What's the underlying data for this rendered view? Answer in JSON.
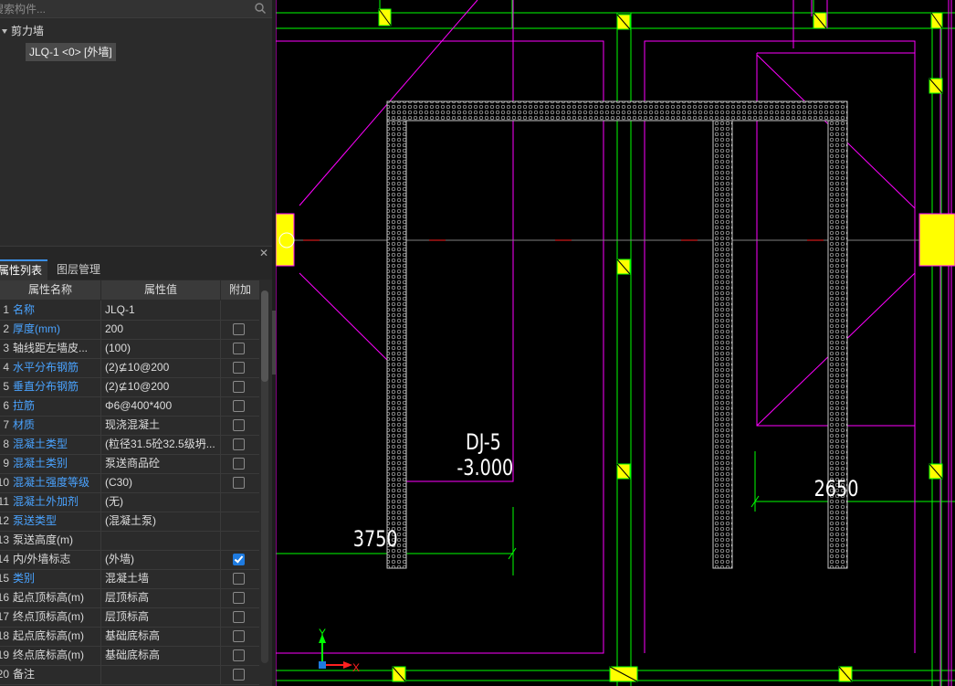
{
  "search": {
    "placeholder": "搜索构件..."
  },
  "tree": {
    "root_label": "剪力墙",
    "child_label": "JLQ-1 <0> [外墙]"
  },
  "tabs": [
    {
      "label": "属性列表",
      "active": true
    },
    {
      "label": "图层管理",
      "active": false
    }
  ],
  "table": {
    "headers": [
      "属性名称",
      "属性值",
      "附加"
    ],
    "rows": [
      {
        "no": "1",
        "name": "名称",
        "value": "JLQ-1",
        "blue": true,
        "check": null
      },
      {
        "no": "2",
        "name": "厚度(mm)",
        "value": "200",
        "blue": true,
        "check": false
      },
      {
        "no": "3",
        "name": "轴线距左墙皮...",
        "value": "(100)",
        "blue": false,
        "check": false
      },
      {
        "no": "4",
        "name": "水平分布钢筋",
        "value": "(2)⊈10@200",
        "blue": true,
        "check": false
      },
      {
        "no": "5",
        "name": "垂直分布钢筋",
        "value": "(2)⊈10@200",
        "blue": true,
        "check": false
      },
      {
        "no": "6",
        "name": "拉筋",
        "value": "Φ6@400*400",
        "blue": true,
        "check": false
      },
      {
        "no": "7",
        "name": "材质",
        "value": "现浇混凝土",
        "blue": true,
        "check": false
      },
      {
        "no": "8",
        "name": "混凝土类型",
        "value": "(粒径31.5砼32.5级坍...",
        "blue": true,
        "check": false
      },
      {
        "no": "9",
        "name": "混凝土类别",
        "value": "泵送商品砼",
        "blue": true,
        "check": false
      },
      {
        "no": "10",
        "name": "混凝土强度等级",
        "value": "(C30)",
        "blue": true,
        "check": false
      },
      {
        "no": "11",
        "name": "混凝土外加剂",
        "value": "(无)",
        "blue": true,
        "check": null
      },
      {
        "no": "12",
        "name": "泵送类型",
        "value": "(混凝土泵)",
        "blue": true,
        "check": null
      },
      {
        "no": "13",
        "name": "泵送高度(m)",
        "value": "",
        "blue": false,
        "check": null
      },
      {
        "no": "14",
        "name": "内/外墙标志",
        "value": "(外墙)",
        "blue": false,
        "check": true
      },
      {
        "no": "15",
        "name": "类别",
        "value": "混凝土墙",
        "blue": true,
        "check": false
      },
      {
        "no": "16",
        "name": "起点顶标高(m)",
        "value": "层顶标高",
        "blue": false,
        "check": false
      },
      {
        "no": "17",
        "name": "终点顶标高(m)",
        "value": "层顶标高",
        "blue": false,
        "check": false
      },
      {
        "no": "18",
        "name": "起点底标高(m)",
        "value": "基础底标高",
        "blue": false,
        "check": false
      },
      {
        "no": "19",
        "name": "终点底标高(m)",
        "value": "基础底标高",
        "blue": false,
        "check": false
      },
      {
        "no": "20",
        "name": "备注",
        "value": "",
        "blue": false,
        "check": false
      }
    ]
  },
  "cad": {
    "label_name": "DJ-5",
    "label_elev": "-3.000",
    "dim_left": "3750",
    "dim_right": "2650",
    "axis_y": "Y",
    "axis_x": "X",
    "colors": {
      "green": "#00ff00",
      "magenta": "#ff00ff",
      "yellow": "#ffff00",
      "wall": "#c8c8c8",
      "accent_blue": "#1e7be0",
      "link_blue": "#4aa3ff"
    }
  }
}
